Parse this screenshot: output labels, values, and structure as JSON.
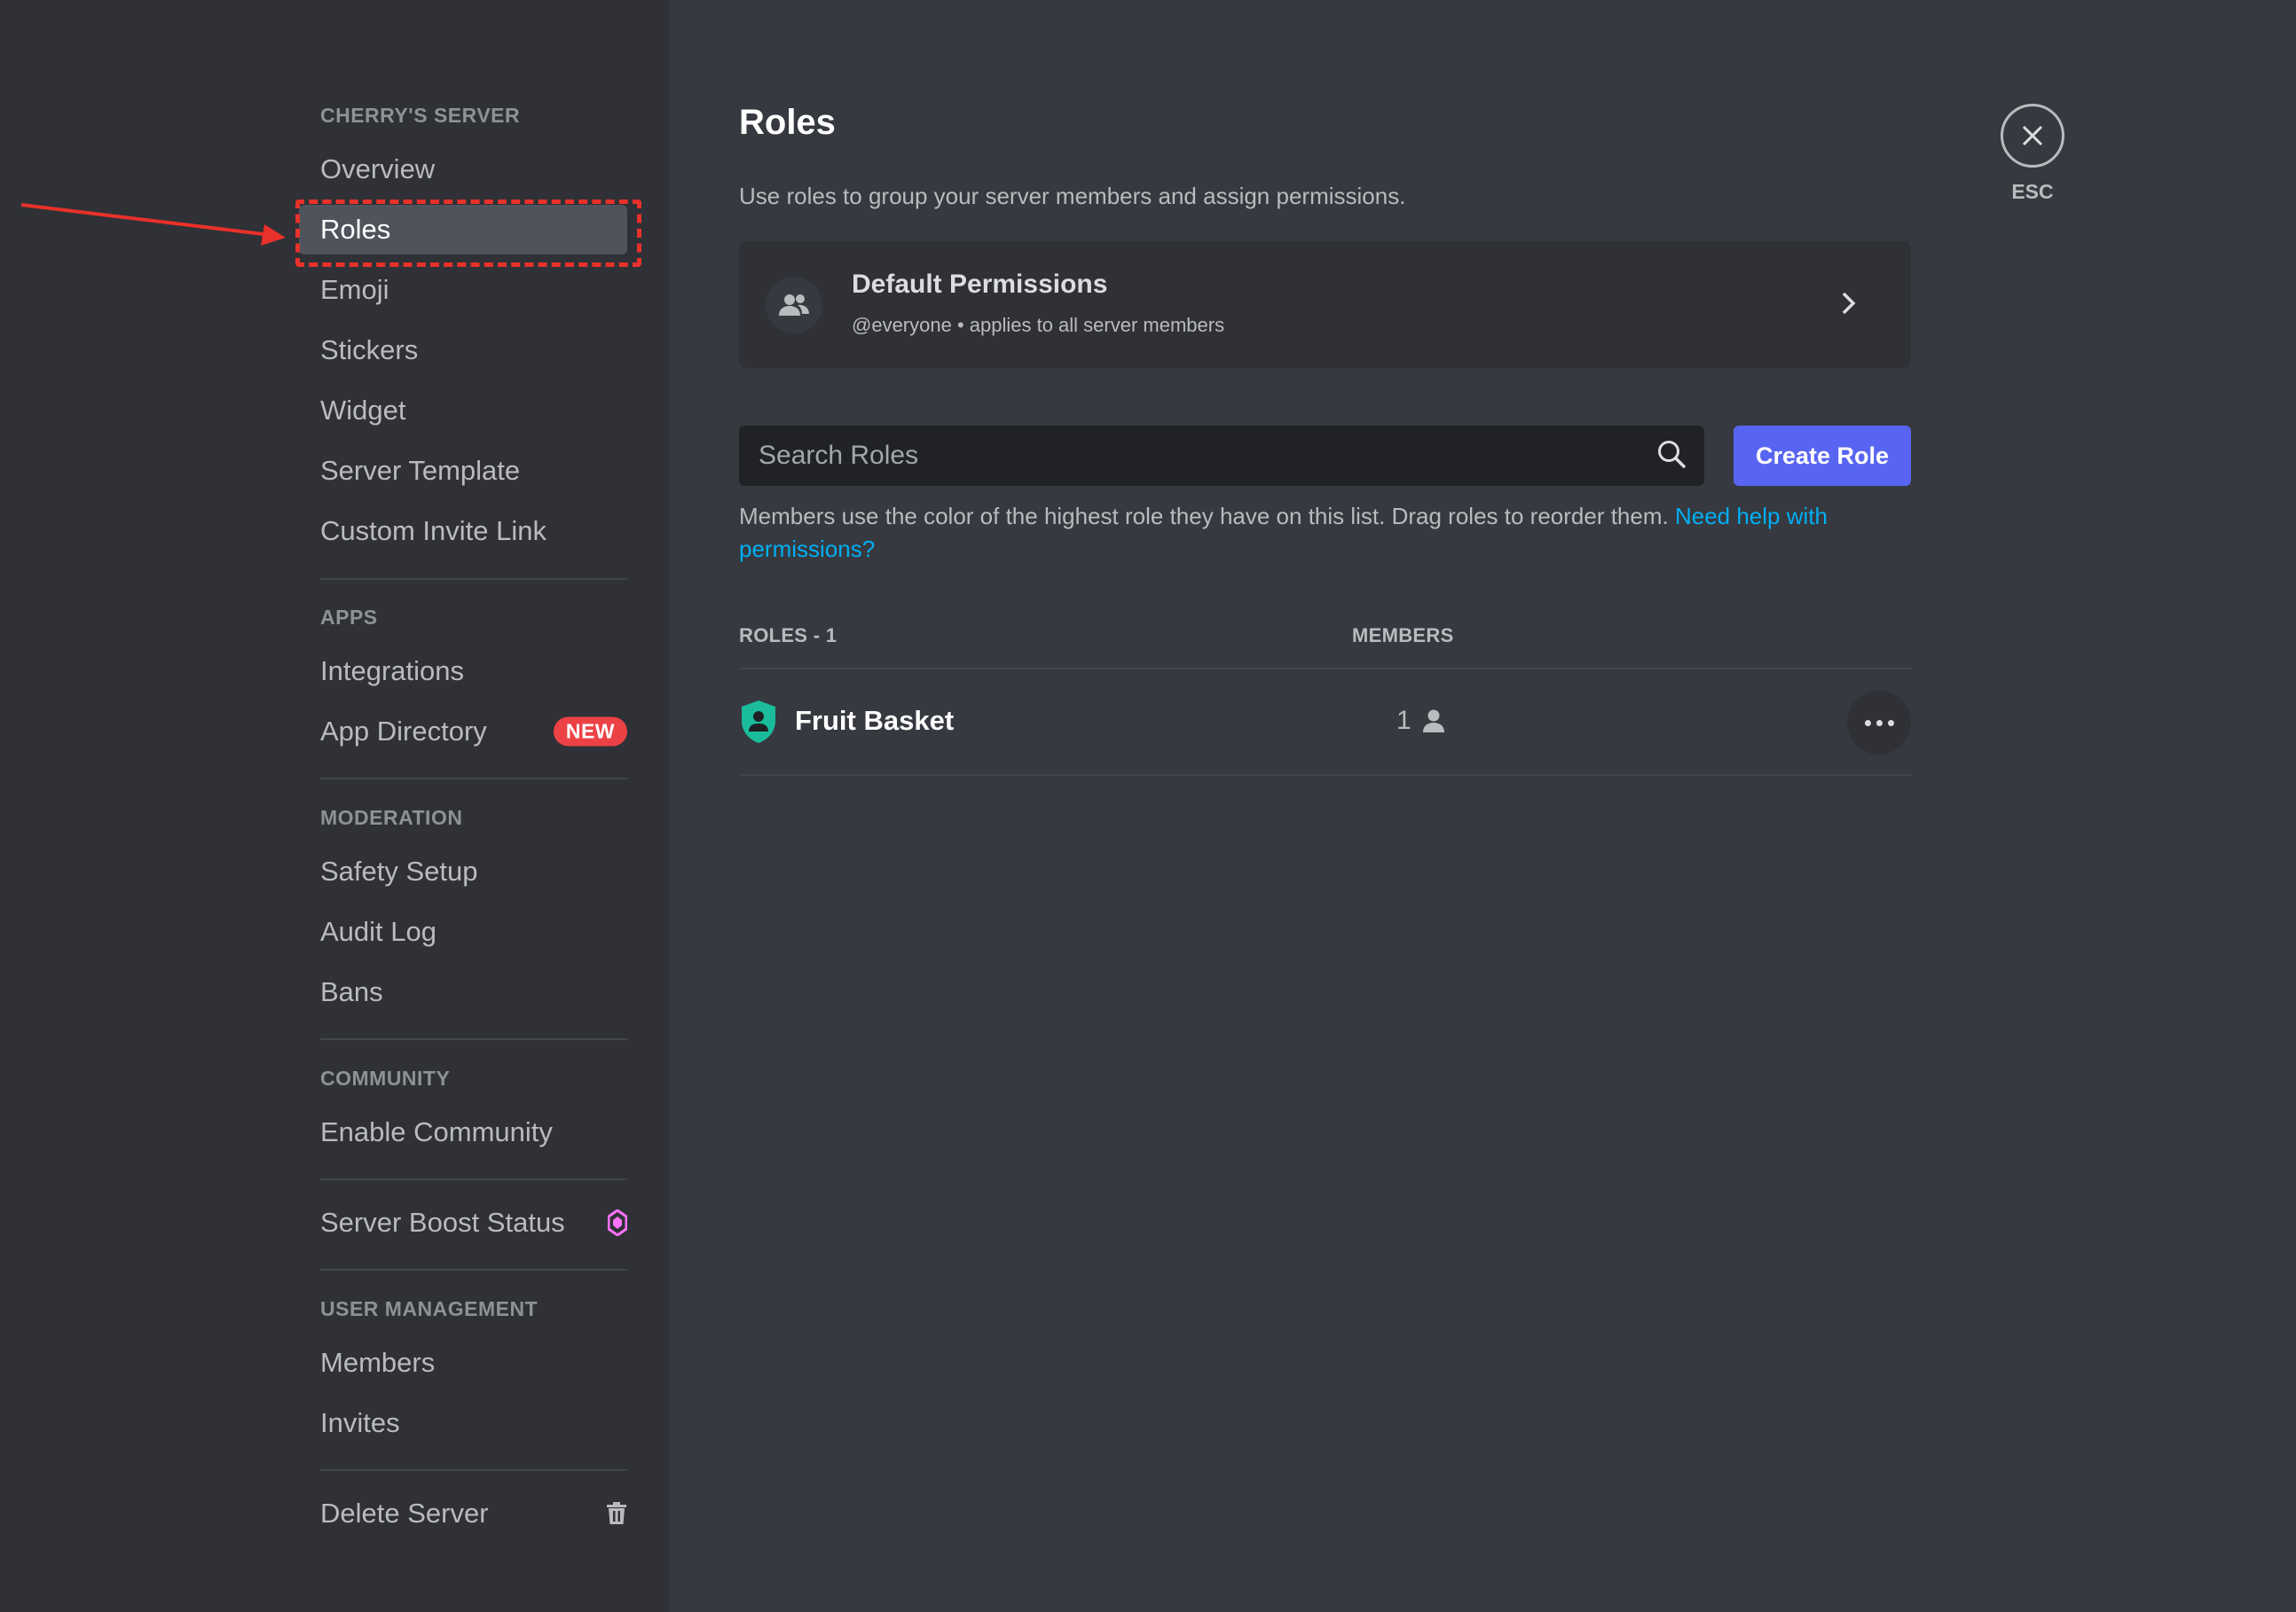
{
  "window": {
    "traffic_lights": [
      "close",
      "minimize",
      "zoom"
    ]
  },
  "sidebar": {
    "server_header": "CHERRY'S SERVER",
    "server_items": [
      {
        "label": "Overview"
      },
      {
        "label": "Roles",
        "active": true
      },
      {
        "label": "Emoji"
      },
      {
        "label": "Stickers"
      },
      {
        "label": "Widget"
      },
      {
        "label": "Server Template"
      },
      {
        "label": "Custom Invite Link"
      }
    ],
    "apps_header": "APPS",
    "apps_items": [
      {
        "label": "Integrations"
      },
      {
        "label": "App Directory",
        "badge": "NEW"
      }
    ],
    "moderation_header": "MODERATION",
    "moderation_items": [
      {
        "label": "Safety Setup"
      },
      {
        "label": "Audit Log"
      },
      {
        "label": "Bans"
      }
    ],
    "community_header": "COMMUNITY",
    "community_items": [
      {
        "label": "Enable Community"
      }
    ],
    "boost_item": {
      "label": "Server Boost Status",
      "icon": "boost-gem-icon"
    },
    "user_mgmt_header": "USER MANAGEMENT",
    "user_mgmt_items": [
      {
        "label": "Members"
      },
      {
        "label": "Invites"
      }
    ],
    "delete_item": {
      "label": "Delete Server",
      "icon": "trash-icon"
    }
  },
  "main": {
    "title": "Roles",
    "subtitle": "Use roles to group your server members and assign permissions.",
    "default_permissions": {
      "title": "Default Permissions",
      "subtitle": "@everyone • applies to all server members"
    },
    "search": {
      "placeholder": "Search Roles",
      "value": ""
    },
    "create_button": "Create Role",
    "help_text": "Members use the color of the highest role they have on this list. Drag roles to reorder them.",
    "help_link": "Need help with permissions?",
    "columns": {
      "roles": "ROLES - 1",
      "members": "MEMBERS"
    },
    "roles": [
      {
        "name": "Fruit Basket",
        "members": "1",
        "color": "#1abc9c"
      }
    ],
    "close": {
      "label": "ESC"
    }
  },
  "colors": {
    "accent": "#5865f2",
    "link": "#00aff4",
    "danger": "#ed4245",
    "annotation": "#e8312a",
    "boost": "#ff73fa"
  }
}
